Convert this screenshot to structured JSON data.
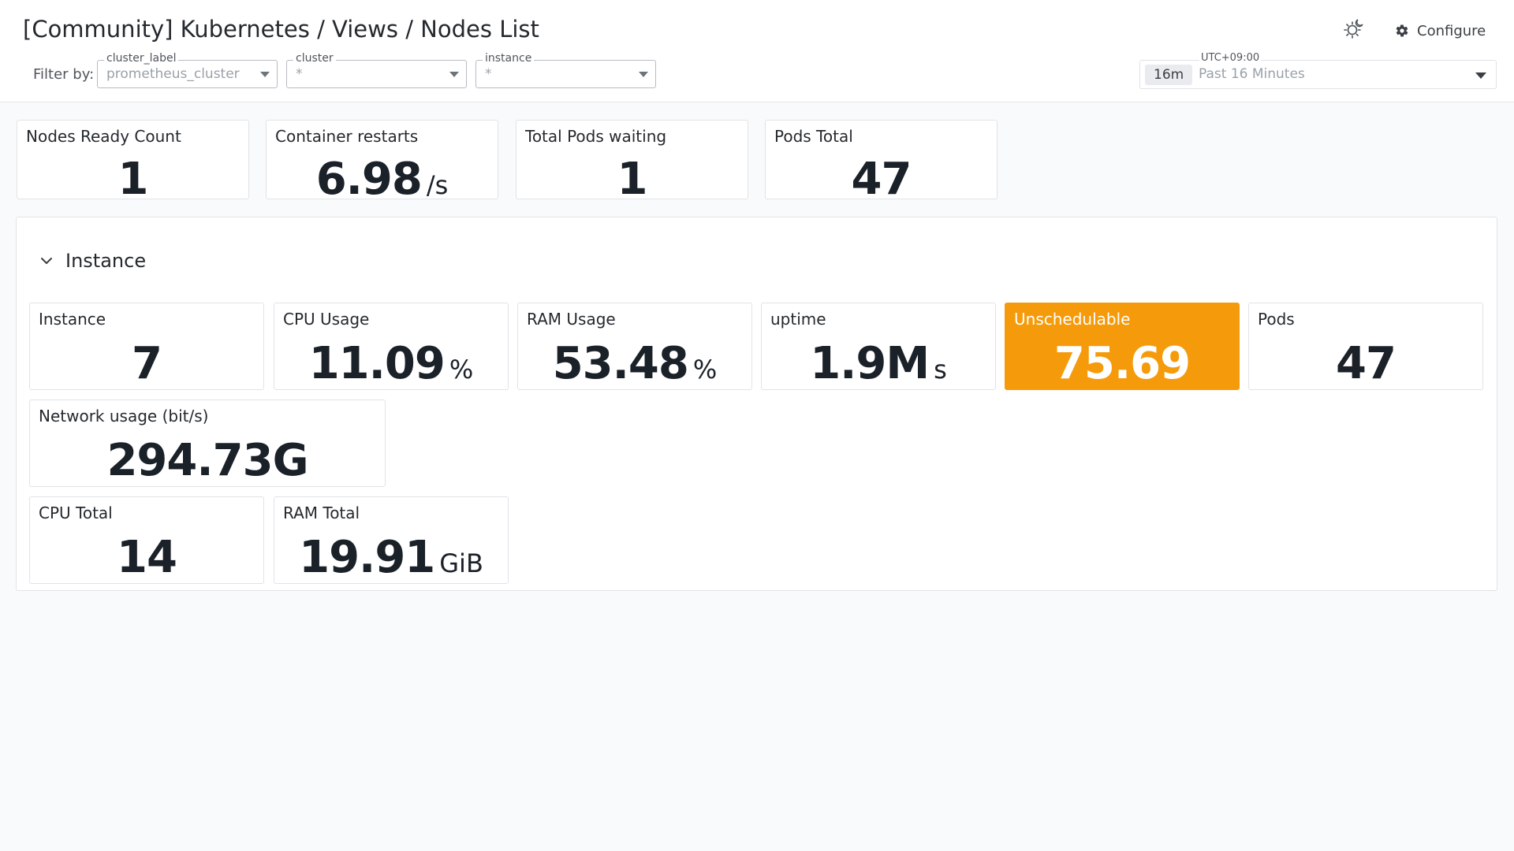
{
  "header": {
    "title": "[Community] Kubernetes / Views / Nodes List",
    "theme_toggle_icon": "sun-moon-icon",
    "configure_label": "Configure",
    "configure_icon": "gear-icon"
  },
  "filters": {
    "label": "Filter by:",
    "items": [
      {
        "legend": "cluster_label",
        "value": "prometheus_cluster"
      },
      {
        "legend": "cluster",
        "value": "*"
      },
      {
        "legend": "instance",
        "value": "*"
      }
    ]
  },
  "time_picker": {
    "timezone": "UTC+09:00",
    "chip": "16m",
    "range": "Past 16 Minutes"
  },
  "top_cards": [
    {
      "label": "Nodes Ready Count",
      "value": "1",
      "unit": ""
    },
    {
      "label": "Container restarts",
      "value": "6.98",
      "unit": "/s"
    },
    {
      "label": "Total Pods waiting",
      "value": "1",
      "unit": ""
    },
    {
      "label": "Pods Total",
      "value": "47",
      "unit": ""
    }
  ],
  "section": {
    "title": "Instance",
    "collapse_icon": "chevron-down-icon",
    "cards": [
      {
        "label": "Instance",
        "value": "7",
        "unit": ""
      },
      {
        "label": "CPU Usage",
        "value": "11.09",
        "unit": "%"
      },
      {
        "label": "RAM Usage",
        "value": "53.48",
        "unit": "%"
      },
      {
        "label": "uptime",
        "value": "1.9M",
        "unit": "s"
      },
      {
        "label": "Unschedulable",
        "value": "75.69",
        "unit": "",
        "highlight_color": "#f59b0b"
      },
      {
        "label": "Pods",
        "value": "47",
        "unit": ""
      },
      {
        "label": "Network usage (bit/s)",
        "value": "294.73G",
        "unit": ""
      },
      {
        "label": "CPU Total",
        "value": "14",
        "unit": ""
      },
      {
        "label": "RAM Total",
        "value": "19.91",
        "unit": "GiB"
      }
    ]
  },
  "colors": {
    "accent_orange": "#f59b0b",
    "page_background": "#f9fafb",
    "card_border": "#e0e3e7"
  }
}
